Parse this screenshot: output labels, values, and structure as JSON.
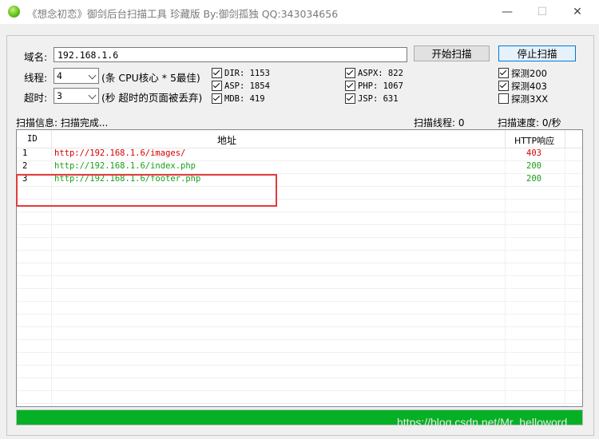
{
  "window": {
    "title": "《想念初恋》御剑后台扫描工具 珍藏版 By:御剑孤独 QQ:343034656",
    "minimize": "—",
    "maximize": "☐",
    "close": "✕"
  },
  "form": {
    "domain_label": "域名:",
    "domain_value": "192.168.1.6",
    "start_button": "开始扫描",
    "stop_button": "停止扫描",
    "threads_label": "线程:",
    "threads_value": "4",
    "threads_hint": "(条 CPU核心 * 5最佳)",
    "timeout_label": "超时:",
    "timeout_value": "3",
    "timeout_hint": "(秒 超时的页面被丢弃)"
  },
  "dictionaries": [
    {
      "label": "DIR: 1153",
      "checked": true
    },
    {
      "label": "ASP: 1854",
      "checked": true
    },
    {
      "label": "MDB: 419",
      "checked": true
    },
    {
      "label": "ASPX: 822",
      "checked": true
    },
    {
      "label": "PHP: 1067",
      "checked": true
    },
    {
      "label": "JSP: 631",
      "checked": true
    }
  ],
  "probes": [
    {
      "label": "探测200",
      "checked": true
    },
    {
      "label": "探测403",
      "checked": true
    },
    {
      "label": "探测3XX",
      "checked": false
    }
  ],
  "status": {
    "info": "扫描信息: 扫描完成...",
    "threads": "扫描线程: 0",
    "speed": "扫描速度: 0/秒"
  },
  "table": {
    "columns": [
      "ID",
      "地址",
      "HTTP响应"
    ],
    "rows": [
      {
        "id": "1",
        "url": "http://192.168.1.6/images/",
        "code": "403",
        "color": "#d40000"
      },
      {
        "id": "2",
        "url": "http://192.168.1.6/index.php",
        "code": "200",
        "color": "#1a9e1a"
      },
      {
        "id": "3",
        "url": "http://192.168.1.6/footer.php",
        "code": "200",
        "color": "#1a9e1a"
      }
    ]
  },
  "progress_percent": 100,
  "watermark": "https://blog.csdn.net/Mr_helloword",
  "colors": {
    "progress": "#06b025",
    "highlight": "#e23b3b",
    "code_403": "#d40000",
    "code_200": "#1a9e1a"
  }
}
